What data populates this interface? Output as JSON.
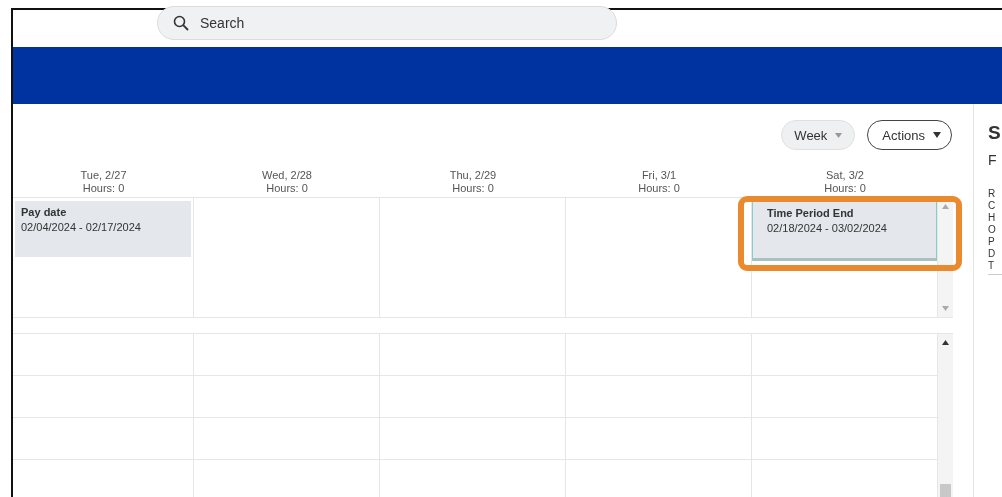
{
  "search": {
    "placeholder": "Search"
  },
  "toolbar": {
    "view": "Week",
    "actions": "Actions"
  },
  "days": [
    {
      "date": "Tue, 2/27",
      "hours": "Hours: 0",
      "event": {
        "title": "Pay date",
        "range": "02/04/2024 - 02/17/2024",
        "highlighted": false
      }
    },
    {
      "date": "Wed, 2/28",
      "hours": "Hours: 0"
    },
    {
      "date": "Thu, 2/29",
      "hours": "Hours: 0"
    },
    {
      "date": "Fri, 3/1",
      "hours": "Hours: 0"
    },
    {
      "date": "Sat, 3/2",
      "hours": "Hours: 0",
      "event": {
        "title": "Time Period End",
        "range": "02/18/2024 - 03/02/2024",
        "highlighted": true
      }
    }
  ],
  "side_panel": {
    "title": "S",
    "subtitle": "F",
    "rows": [
      "R",
      "C",
      "H",
      "O",
      "P",
      "D",
      "T"
    ]
  }
}
